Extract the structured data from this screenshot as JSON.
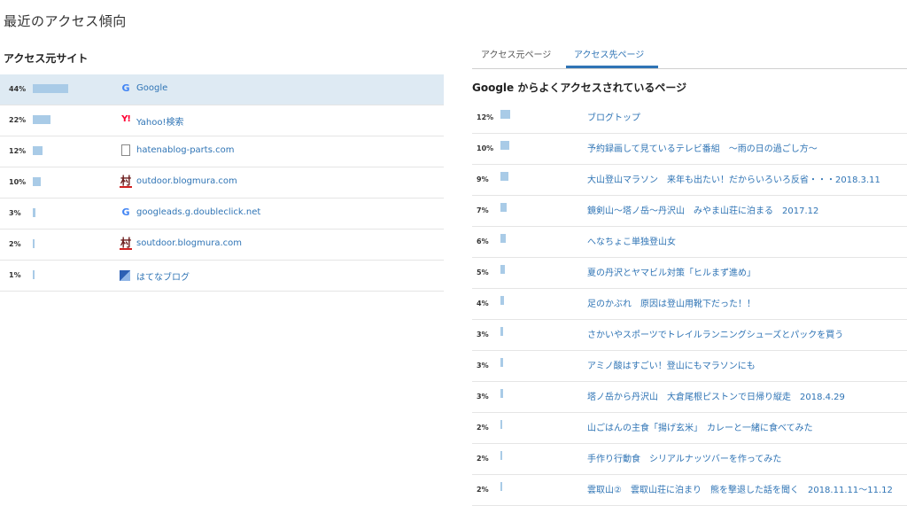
{
  "page": {
    "title": "最近のアクセス傾向"
  },
  "sources": {
    "title": "アクセス元サイト",
    "rows": [
      {
        "pct": "44%",
        "share": 44,
        "icon": "google-icon",
        "name": "Google"
      },
      {
        "pct": "22%",
        "share": 22,
        "icon": "yahoo-icon",
        "name": "Yahoo!検索"
      },
      {
        "pct": "12%",
        "share": 12,
        "icon": "page-icon",
        "name": "hatenablog-parts.com"
      },
      {
        "pct": "10%",
        "share": 10,
        "icon": "blogmura-icon",
        "name": "outdoor.blogmura.com"
      },
      {
        "pct": "3%",
        "share": 3,
        "icon": "google-icon",
        "name": "googleads.g.doubleclick.net"
      },
      {
        "pct": "2%",
        "share": 2,
        "icon": "blogmura-icon",
        "name": "soutdoor.blogmura.com"
      },
      {
        "pct": "1%",
        "share": 1,
        "icon": "hatena-icon",
        "name": "はてなブログ"
      }
    ]
  },
  "tabs": [
    {
      "label": "アクセス元ページ",
      "active": false
    },
    {
      "label": "アクセス先ページ",
      "active": true
    }
  ],
  "pages": {
    "title": "Google からよくアクセスされているページ",
    "rows": [
      {
        "pct": "12%",
        "share": 12,
        "title": "ブログトップ"
      },
      {
        "pct": "10%",
        "share": 10,
        "title": "予約録画して見ているテレビ番組　～雨の日の過ごし方～"
      },
      {
        "pct": "9%",
        "share": 9,
        "title": "大山登山マラソン　来年も出たい！だからいろいろ反省・・・2018.3.11"
      },
      {
        "pct": "7%",
        "share": 7,
        "title": "鏡剣山～塔ノ岳～丹沢山　みやま山荘に泊まる　2017.12"
      },
      {
        "pct": "6%",
        "share": 6,
        "title": "へなちょこ単独登山女"
      },
      {
        "pct": "5%",
        "share": 5,
        "title": "夏の丹沢とヤマビル対策「ヒルまず進め」"
      },
      {
        "pct": "4%",
        "share": 4,
        "title": "足のかぶれ　原因は登山用靴下だった！！"
      },
      {
        "pct": "3%",
        "share": 3,
        "title": "さかいやスポーツでトレイルランニングシューズとパックを買う"
      },
      {
        "pct": "3%",
        "share": 3,
        "title": "アミノ酸はすごい！登山にもマラソンにも"
      },
      {
        "pct": "3%",
        "share": 3,
        "title": "塔ノ岳から丹沢山　大倉尾根ピストンで日帰り縦走　2018.4.29"
      },
      {
        "pct": "2%",
        "share": 2,
        "title": "山ごはんの主食「揚げ玄米」　カレーと一緒に食べてみた"
      },
      {
        "pct": "2%",
        "share": 2,
        "title": "手作り行動食　シリアルナッツバーを作ってみた"
      },
      {
        "pct": "2%",
        "share": 2,
        "title": "雲取山②　雲取山荘に泊まり　熊を撃退した話を聞く　2018.11.11～11.12"
      }
    ]
  },
  "colors": {
    "link": "#2f74b5",
    "bar": "#a9cbe7",
    "highlight": "#deeaf3"
  }
}
